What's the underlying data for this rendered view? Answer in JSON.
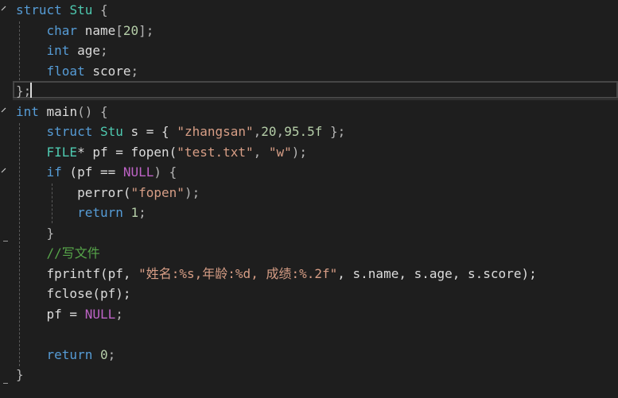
{
  "editor": {
    "background": "#1e1e1e",
    "lines": [
      {
        "tokens": [
          {
            "t": "struct",
            "c": "kw"
          },
          {
            "t": " ",
            "c": "id"
          },
          {
            "t": "Stu",
            "c": "type"
          },
          {
            "t": " {",
            "c": "punc"
          }
        ]
      },
      {
        "tokens": [
          {
            "t": "    ",
            "c": "id"
          },
          {
            "t": "char",
            "c": "kw"
          },
          {
            "t": " name",
            "c": "field"
          },
          {
            "t": "[",
            "c": "punc"
          },
          {
            "t": "20",
            "c": "num"
          },
          {
            "t": "];",
            "c": "punc"
          }
        ]
      },
      {
        "tokens": [
          {
            "t": "    ",
            "c": "id"
          },
          {
            "t": "int",
            "c": "kw"
          },
          {
            "t": " age",
            "c": "field"
          },
          {
            "t": ";",
            "c": "punc"
          }
        ]
      },
      {
        "tokens": [
          {
            "t": "    ",
            "c": "id"
          },
          {
            "t": "float",
            "c": "kw"
          },
          {
            "t": " score",
            "c": "field"
          },
          {
            "t": ";",
            "c": "punc"
          }
        ]
      },
      {
        "tokens": [
          {
            "t": "};",
            "c": "punc"
          }
        ]
      },
      {
        "tokens": [
          {
            "t": "int",
            "c": "kw"
          },
          {
            "t": " main",
            "c": "fn"
          },
          {
            "t": "() {",
            "c": "punc"
          }
        ]
      },
      {
        "tokens": [
          {
            "t": "    ",
            "c": "id"
          },
          {
            "t": "struct",
            "c": "kw"
          },
          {
            "t": " ",
            "c": "id"
          },
          {
            "t": "Stu",
            "c": "type"
          },
          {
            "t": " s = { ",
            "c": "id"
          },
          {
            "t": "\"zhangsan\"",
            "c": "str"
          },
          {
            "t": ",",
            "c": "punc"
          },
          {
            "t": "20",
            "c": "num"
          },
          {
            "t": ",",
            "c": "punc"
          },
          {
            "t": "95.5f",
            "c": "num"
          },
          {
            "t": " };",
            "c": "punc"
          }
        ]
      },
      {
        "tokens": [
          {
            "t": "    ",
            "c": "id"
          },
          {
            "t": "FILE",
            "c": "type"
          },
          {
            "t": "* pf = fopen(",
            "c": "id"
          },
          {
            "t": "\"test.txt\"",
            "c": "str"
          },
          {
            "t": ", ",
            "c": "punc"
          },
          {
            "t": "\"w\"",
            "c": "str"
          },
          {
            "t": ");",
            "c": "punc"
          }
        ]
      },
      {
        "tokens": [
          {
            "t": "    ",
            "c": "id"
          },
          {
            "t": "if",
            "c": "kw"
          },
          {
            "t": " (pf == ",
            "c": "id"
          },
          {
            "t": "NULL",
            "c": "macro"
          },
          {
            "t": ") {",
            "c": "punc"
          }
        ]
      },
      {
        "tokens": [
          {
            "t": "        ",
            "c": "id"
          },
          {
            "t": "perror(",
            "c": "id"
          },
          {
            "t": "\"fopen\"",
            "c": "str"
          },
          {
            "t": ");",
            "c": "punc"
          }
        ]
      },
      {
        "tokens": [
          {
            "t": "        ",
            "c": "id"
          },
          {
            "t": "return",
            "c": "kw"
          },
          {
            "t": " ",
            "c": "id"
          },
          {
            "t": "1",
            "c": "num"
          },
          {
            "t": ";",
            "c": "punc"
          }
        ]
      },
      {
        "tokens": [
          {
            "t": "    }",
            "c": "punc"
          }
        ]
      },
      {
        "tokens": [
          {
            "t": "    ",
            "c": "id"
          },
          {
            "t": "//写文件",
            "c": "cm"
          }
        ]
      },
      {
        "tokens": [
          {
            "t": "    ",
            "c": "id"
          },
          {
            "t": "fprintf(pf, ",
            "c": "id"
          },
          {
            "t": "\"姓名:%s,年龄:%d, 成绩:%.2f\"",
            "c": "str"
          },
          {
            "t": ", s.name, s.age, s.score);",
            "c": "id"
          }
        ]
      },
      {
        "tokens": [
          {
            "t": "    ",
            "c": "id"
          },
          {
            "t": "fclose(pf);",
            "c": "id"
          }
        ]
      },
      {
        "tokens": [
          {
            "t": "    pf = ",
            "c": "id"
          },
          {
            "t": "NULL",
            "c": "macro"
          },
          {
            "t": ";",
            "c": "punc"
          }
        ]
      },
      {
        "tokens": [
          {
            "t": "",
            "c": "id"
          }
        ]
      },
      {
        "tokens": [
          {
            "t": "    ",
            "c": "id"
          },
          {
            "t": "return",
            "c": "kw"
          },
          {
            "t": " ",
            "c": "id"
          },
          {
            "t": "0",
            "c": "num"
          },
          {
            "t": ";",
            "c": "punc"
          }
        ]
      },
      {
        "tokens": [
          {
            "t": "}",
            "c": "punc"
          }
        ]
      }
    ]
  }
}
